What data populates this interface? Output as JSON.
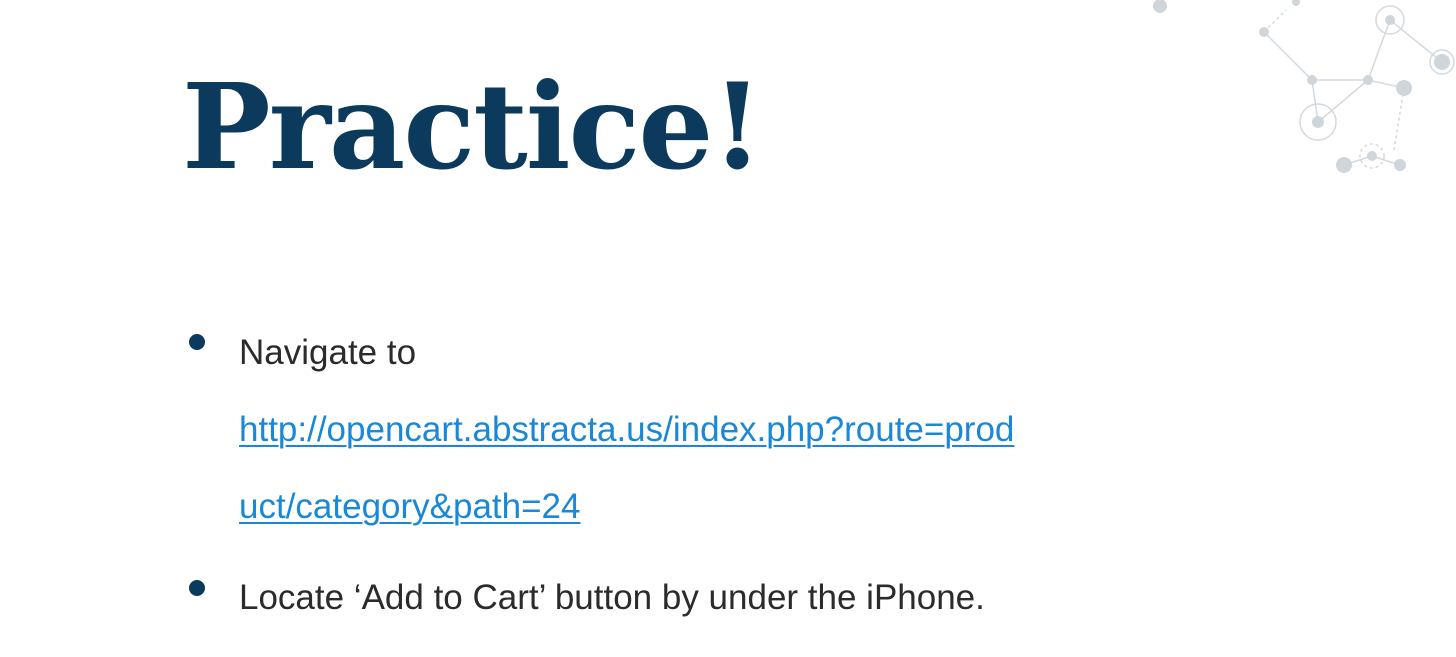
{
  "slide": {
    "title": "Practice!",
    "bullets": [
      {
        "lead_text": "Navigate to",
        "link_line_1": "http://opencart.abstracta.us/index.php?route=prod",
        "link_line_2": "uct/category&path=24"
      },
      {
        "text": "Locate ‘Add to Cart’ button by under the iPhone."
      }
    ]
  },
  "colors": {
    "title": "#0b3a5c",
    "bullet": "#0b3a5c",
    "body_text": "#2b2b2b",
    "link": "#1a88d8",
    "decoration": "#cfd6db"
  },
  "decoration": {
    "icon": "network-nodes-icon"
  }
}
